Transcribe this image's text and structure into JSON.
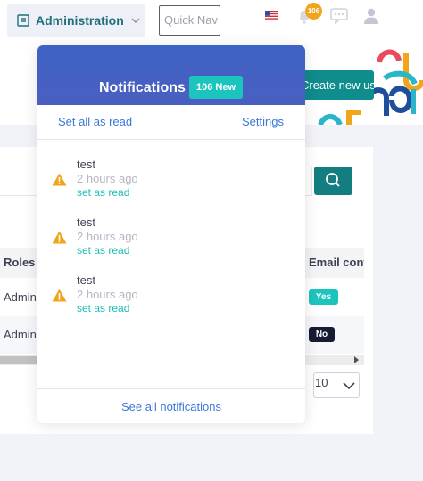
{
  "topbar": {
    "admin_label": "Administration",
    "quicknav_placeholder": "Quick Nav",
    "notification_badge": "106"
  },
  "page": {
    "create_button": "Create new user",
    "table": {
      "headers": [
        "Roles",
        "Email confirmed"
      ],
      "rows": [
        {
          "role": "Admin",
          "email_confirmed": "Yes"
        },
        {
          "role": "Admin",
          "email_confirmed": "No"
        }
      ]
    },
    "page_size": "10"
  },
  "notifications": {
    "title": "Notifications",
    "new_count": "106 New",
    "set_all_read": "Set all as read",
    "settings": "Settings",
    "items": [
      {
        "title": "test",
        "time": "2 hours ago",
        "action": "set as read"
      },
      {
        "title": "test",
        "time": "2 hours ago",
        "action": "set as read"
      },
      {
        "title": "test",
        "time": "2 hours ago",
        "action": "set as read"
      }
    ],
    "see_all": "See all notifications"
  },
  "colors": {
    "accent_teal": "#1bc5bd",
    "header_blue": "#3e63c5",
    "warning": "#f0a51a",
    "link_blue": "#3c78d8"
  },
  "icons": [
    "admin-icon",
    "chevron-down-icon",
    "us-flag-icon",
    "bell-icon",
    "chat-icon",
    "user-icon",
    "search-icon",
    "warning-icon"
  ]
}
